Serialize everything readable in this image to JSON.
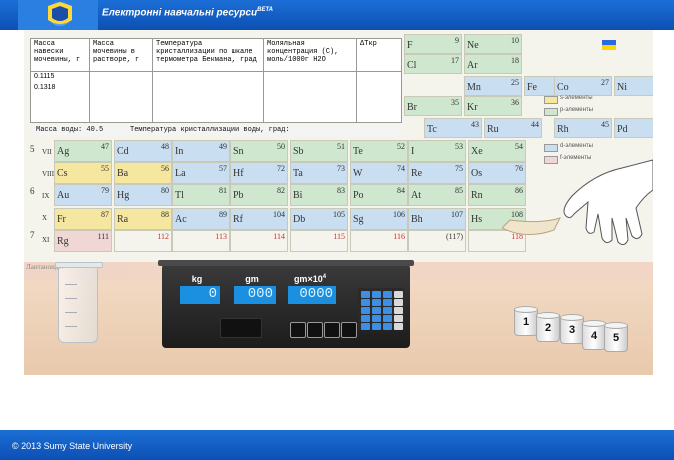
{
  "header": {
    "title": "Електронні навчальні ресурси",
    "beta": "BETA"
  },
  "data_table": {
    "headers": [
      "Масса навески мочевины, г",
      "Масса мочевины в растворе, г",
      "Температура кристаллизации по шкале термометра Бекмана, град",
      "Моляльная концентрация (С), моль/1000г H2O",
      "ΔTкр"
    ],
    "rows": [
      {
        "mass": "0.1115"
      },
      {
        "mass": "0.1318"
      }
    ]
  },
  "water_line": {
    "mass_label": "Масса воды: 40.5",
    "temp_label": "Температура кристаллизации воды, град:"
  },
  "periodic": {
    "lanthanides_label": "Лантаноиды",
    "period_labels": [
      "5",
      "6",
      "7"
    ],
    "row_labels": [
      "VII",
      "VIII",
      "IX",
      "X",
      "XI"
    ],
    "right_top": [
      {
        "sym": "F",
        "num": "9"
      },
      {
        "sym": "Ne",
        "num": "10"
      },
      {
        "sym": "Cl",
        "num": "17"
      },
      {
        "sym": "Ar",
        "num": "18"
      },
      {
        "sym": "Mn",
        "num": "25"
      },
      {
        "sym": "Fe",
        "num": "26"
      },
      {
        "sym": "Co",
        "num": "27"
      },
      {
        "sym": "Ni",
        "num": "28"
      },
      {
        "sym": "Br",
        "num": "35"
      },
      {
        "sym": "Kr",
        "num": "36"
      },
      {
        "sym": "Tc",
        "num": "43"
      },
      {
        "sym": "Ru",
        "num": "44"
      },
      {
        "sym": "Rh",
        "num": "45"
      },
      {
        "sym": "Pd",
        "num": "46"
      }
    ],
    "rowVII": [
      {
        "sym": "Ag",
        "num": "47"
      },
      {
        "sym": "Cd",
        "num": "48"
      },
      {
        "sym": "In",
        "num": "49"
      },
      {
        "sym": "Sn",
        "num": "50"
      },
      {
        "sym": "Sb",
        "num": "51"
      },
      {
        "sym": "Te",
        "num": "52"
      },
      {
        "sym": "I",
        "num": "53"
      },
      {
        "sym": "Xe",
        "num": "54"
      }
    ],
    "rowVIII": [
      {
        "sym": "Cs",
        "num": "55"
      },
      {
        "sym": "Ba",
        "num": "56"
      },
      {
        "sym": "La",
        "num": "57"
      },
      {
        "sym": "Hf",
        "num": "72"
      },
      {
        "sym": "Ta",
        "num": "73"
      },
      {
        "sym": "W",
        "num": "74"
      },
      {
        "sym": "Re",
        "num": "75"
      },
      {
        "sym": "Os",
        "num": "76"
      }
    ],
    "rowIX": [
      {
        "sym": "Au",
        "num": "79"
      },
      {
        "sym": "Hg",
        "num": "80"
      },
      {
        "sym": "Tl",
        "num": "81"
      },
      {
        "sym": "Pb",
        "num": "82"
      },
      {
        "sym": "Bi",
        "num": "83"
      },
      {
        "sym": "Po",
        "num": "84"
      },
      {
        "sym": "At",
        "num": "85"
      },
      {
        "sym": "Rn",
        "num": "86"
      }
    ],
    "rowX": [
      {
        "sym": "Fr",
        "num": "87"
      },
      {
        "sym": "Ra",
        "num": "88"
      },
      {
        "sym": "Ac",
        "num": "89"
      },
      {
        "sym": "Rf",
        "num": "104"
      },
      {
        "sym": "Db",
        "num": "105"
      },
      {
        "sym": "Sg",
        "num": "106"
      },
      {
        "sym": "Bh",
        "num": "107"
      },
      {
        "sym": "Hs",
        "num": "108"
      }
    ],
    "rowXI": [
      {
        "sym": "Rg",
        "num": "111"
      },
      {
        "sym": "",
        "num": "112"
      },
      {
        "sym": "",
        "num": "113"
      },
      {
        "sym": "",
        "num": "114"
      },
      {
        "sym": "",
        "num": "115"
      },
      {
        "sym": "",
        "num": "116"
      },
      {
        "sym": "",
        "num": "(117)"
      },
      {
        "sym": "",
        "num": "118"
      }
    ],
    "legend": [
      "s-элементы",
      "p-элементы",
      "d-элементы",
      "f-элементы"
    ]
  },
  "scale": {
    "labels": [
      "kg",
      "gm",
      "gm×10"
    ],
    "power": "4",
    "readings": [
      "0",
      "000",
      "0000"
    ]
  },
  "cups": [
    "1",
    "2",
    "3",
    "4",
    "5"
  ],
  "footer": {
    "text": "© 2013 Sumy State University"
  },
  "colors": {
    "header_blue": "#1b6fd6",
    "lcd_blue": "#1b8fe0",
    "s_block": "#f5e6a0",
    "p_block": "#cfe7cf",
    "d_block": "#c9def1",
    "f_block": "#f1d6d6"
  }
}
